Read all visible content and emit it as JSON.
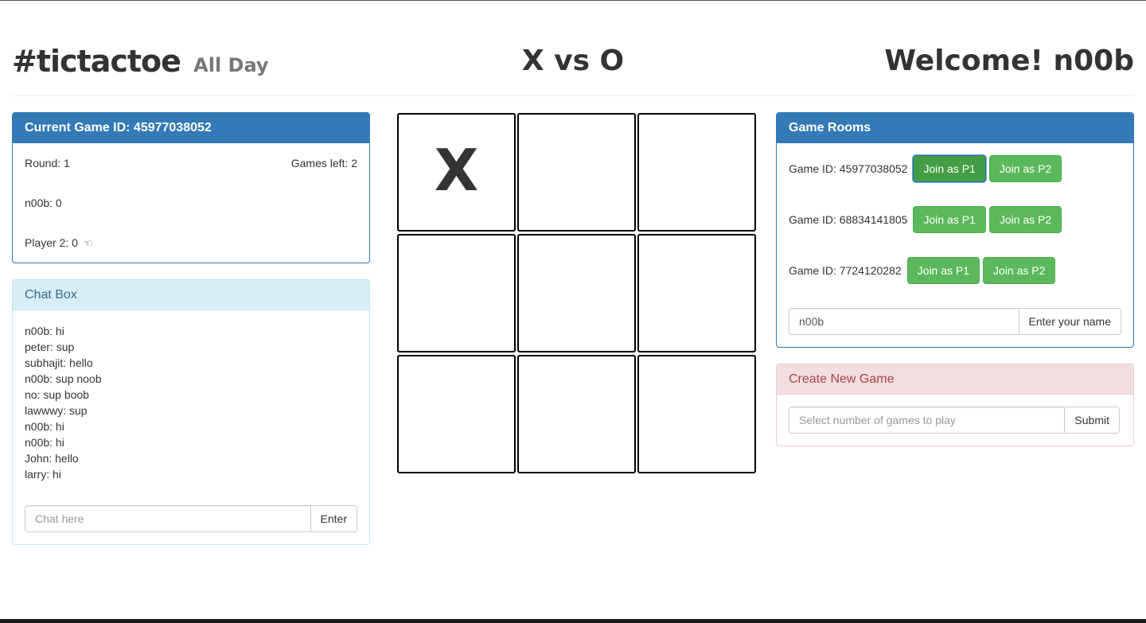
{
  "header": {
    "brand": "#tictactoe",
    "brand_sub": "All Day",
    "title": "X vs O",
    "welcome": "Welcome! n00b"
  },
  "current_game": {
    "heading": "Current Game ID: 45977038052",
    "round": "Round: 1",
    "games_left": "Games left: 2",
    "player1_score": "n00b: 0",
    "player2_score": "Player 2: 0",
    "turn_icon": "pointing-hand-icon"
  },
  "chat": {
    "heading": "Chat Box",
    "messages": [
      "n00b: hi",
      "peter: sup",
      "subhajit: hello",
      "n00b: sup noob",
      "no: sup boob",
      "lawwwy: sup",
      "n00b: hi",
      "n00b: hi",
      "John: hello",
      "larry: hi"
    ],
    "input_placeholder": "Chat here",
    "enter_label": "Enter"
  },
  "board": {
    "cells": [
      "X",
      "",
      "",
      "",
      "",
      "",
      "",
      "",
      ""
    ]
  },
  "rooms": {
    "heading": "Game Rooms",
    "list": [
      {
        "label": "Game ID: 45977038052",
        "join_p1": "Join as P1",
        "join_p2": "Join as P2"
      },
      {
        "label": "Game ID: 68834141805",
        "join_p1": "Join as P1",
        "join_p2": "Join as P2"
      },
      {
        "label": "Game ID: 7724120282",
        "join_p1": "Join as P1",
        "join_p2": "Join as P2"
      }
    ],
    "name_value": "n00b",
    "name_button": "Enter your name"
  },
  "create_game": {
    "heading": "Create New Game",
    "placeholder": "Select number of games to play",
    "submit_label": "Submit"
  },
  "colors": {
    "primary": "#337ab7",
    "success": "#5cb85c",
    "info_bg": "#d9edf7",
    "danger_bg": "#f2dede"
  }
}
